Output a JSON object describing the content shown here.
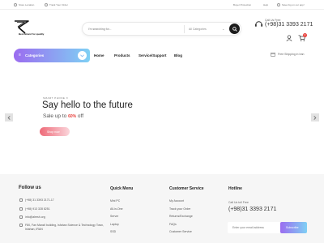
{
  "topbar": {
    "store_location": "Store Location",
    "track_order": "Track Your Order",
    "buyer_protection": "Buyer Protection",
    "help": "Help",
    "save_big": "Save big on our app!"
  },
  "logo": {
    "tagline": "Best Brand for quality"
  },
  "search": {
    "placeholder": "I'm searching for...",
    "category": "All Categories"
  },
  "hotline": {
    "label": "Call Us Free",
    "number": "(+98)31 3393 2171"
  },
  "cart": {
    "count": "0"
  },
  "nav": {
    "categories_label": "Categories",
    "items": [
      "Home",
      "Products",
      "Service/Support",
      "Blog"
    ],
    "shipping": "Free Shipping in Iran"
  },
  "hero": {
    "subtitle": "SMART PHONE X",
    "title": "Say hello to the future",
    "sale_prefix": "Sale up to",
    "sale_pct": "60%",
    "sale_suffix": "off",
    "shop_label": "Shop now"
  },
  "footer": {
    "follow_title": "Follow us",
    "contacts": {
      "phone1": "(+98) 31 3393 2171-17",
      "phone2": "(+98) 913 328 8251",
      "email": "info@alresh.org",
      "address": "F80, Fan Manzil building, Isfahan Science & Technology Town, Isfahan, IRAN"
    },
    "quick_menu": {
      "title": "Quick Menu",
      "items": [
        "Mini PC",
        "All-in-One",
        "Server",
        "Laptop",
        "SSD"
      ]
    },
    "customer_service": {
      "title": "Customer Service",
      "items": [
        "My Account",
        "Track your Order",
        "Returns/Exchange",
        "FAQs",
        "Customer Service"
      ]
    },
    "hotline": {
      "title": "Hotline",
      "label": "Call Us toll Free",
      "number": "(+98)31 3393 2171",
      "email_placeholder": "Enter your email address",
      "subscribe": "Subscribe"
    }
  },
  "colors": {
    "accent_gradient_start": "#9b6cf0",
    "accent_gradient_end": "#7fd0f4",
    "sale_red": "#e8403c"
  }
}
